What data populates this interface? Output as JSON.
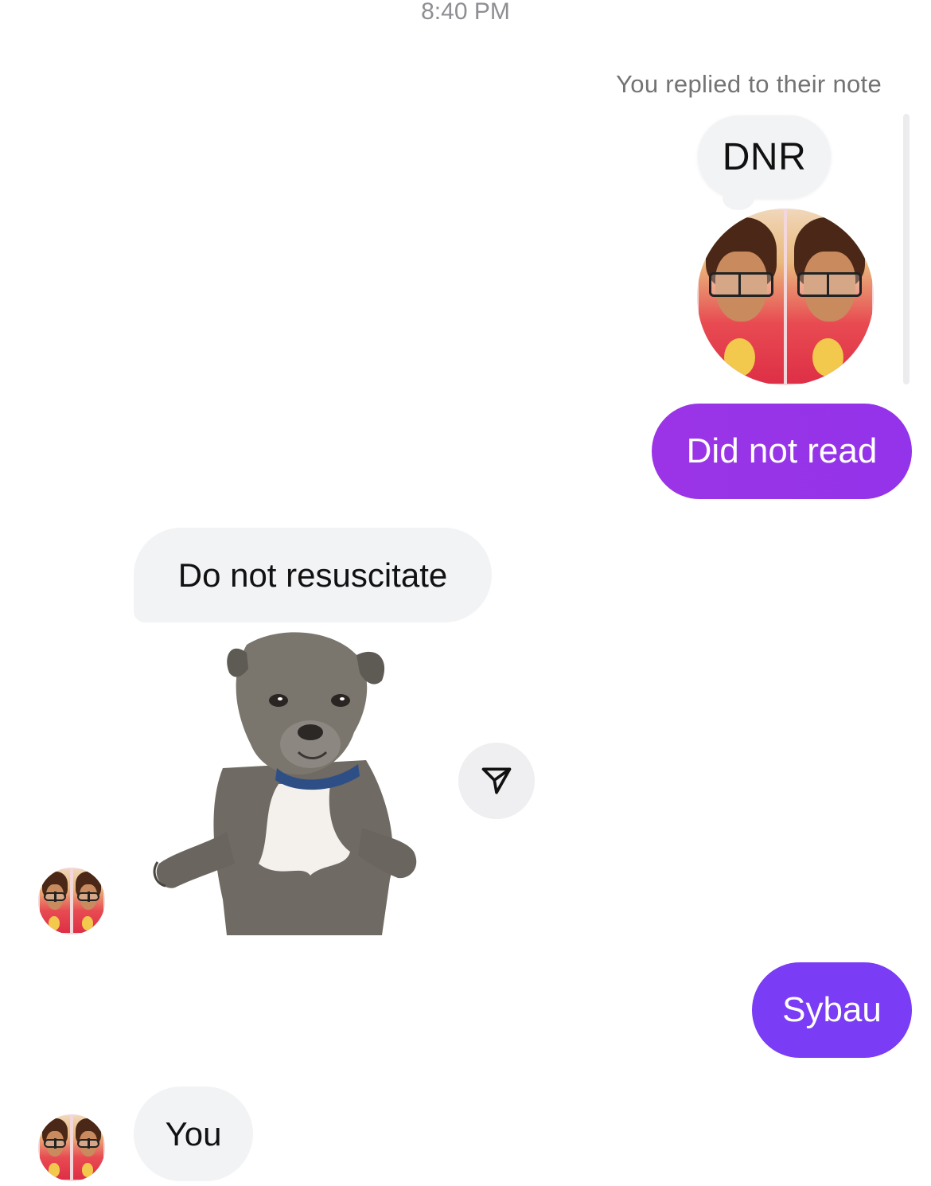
{
  "header": {
    "timestamp": "8:40 PM"
  },
  "note_reply": {
    "caption": "You replied to their note",
    "note_text": "DNR"
  },
  "messages": [
    {
      "direction": "outgoing",
      "text": "Did not read",
      "color": "#9333ea"
    },
    {
      "direction": "incoming",
      "text": "Do not resuscitate"
    },
    {
      "direction": "incoming",
      "type": "sticker",
      "sticker": "sad-puppy"
    },
    {
      "direction": "outgoing",
      "text": "Sybau",
      "color": "#7a3cf4"
    },
    {
      "direction": "incoming",
      "text": "You"
    }
  ],
  "icons": {
    "share": "send-icon",
    "avatar": "contact-avatar"
  },
  "colors": {
    "incoming_bubble": "#f2f3f5",
    "outgoing_bubble_1": "#9333ea",
    "outgoing_bubble_2": "#7a3cf4"
  }
}
